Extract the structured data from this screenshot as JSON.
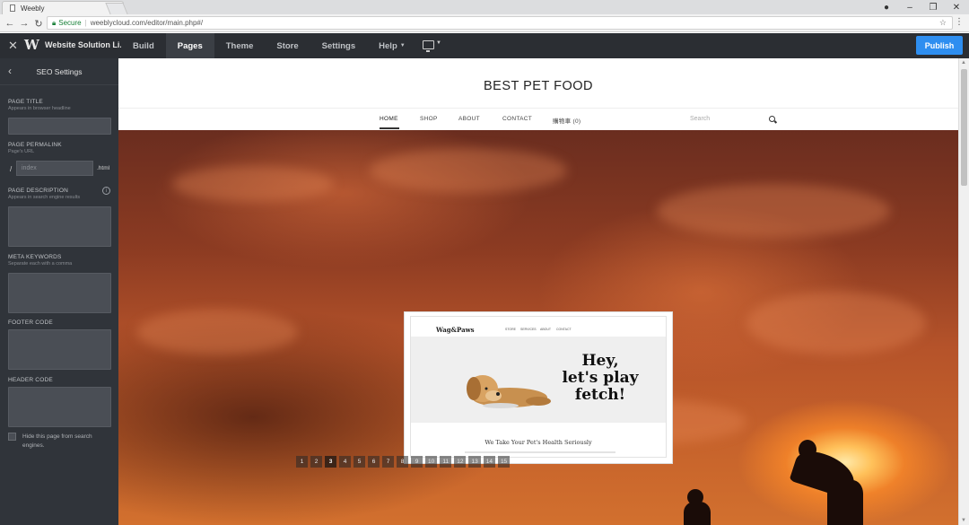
{
  "browser": {
    "tab_title": "Weebly",
    "secure_label": "Secure",
    "url": "weeblycloud.com/editor/main.php#/"
  },
  "editor": {
    "site_name": "Website Solution Li...",
    "nav": [
      {
        "label": "Build"
      },
      {
        "label": "Pages",
        "active": true
      },
      {
        "label": "Theme"
      },
      {
        "label": "Store"
      },
      {
        "label": "Settings"
      },
      {
        "label": "Help"
      }
    ],
    "publish_label": "Publish",
    "accent_color": "#2e8ef0"
  },
  "seo_panel": {
    "title": "SEO Settings",
    "page_title": {
      "label": "PAGE TITLE",
      "sub": "Appears in browser headline",
      "value": ""
    },
    "permalink": {
      "label": "PAGE PERMALINK",
      "sub": "Page's URL",
      "slash": "/",
      "placeholder": "index",
      "suffix": ".html"
    },
    "description": {
      "label": "PAGE DESCRIPTION",
      "sub": "Appears in search engine results",
      "value": ""
    },
    "keywords": {
      "label": "META KEYWORDS",
      "sub": "Separate each with a comma",
      "value": ""
    },
    "footer_code": {
      "label": "FOOTER CODE",
      "value": ""
    },
    "header_code": {
      "label": "HEADER CODE",
      "value": ""
    },
    "hide_page_label": "Hide this page from search engines."
  },
  "site": {
    "title": "BEST PET FOOD",
    "nav": [
      {
        "label": "HOME",
        "active": true
      },
      {
        "label": "SHOP"
      },
      {
        "label": "ABOUT"
      },
      {
        "label": "CONTACT"
      },
      {
        "label": "購物車 (0)"
      }
    ],
    "search_placeholder": "Search",
    "slide": {
      "logo": "Wag&Paws",
      "nav": [
        "STORE",
        "SERVICES",
        "ABOUT",
        "CONTACT"
      ],
      "headline_lines": [
        "Hey,",
        "let's play",
        "fetch!"
      ],
      "tagline": "We Take Your Pet's Health Seriously"
    },
    "pager": [
      "1",
      "2",
      "3",
      "4",
      "5",
      "6",
      "7",
      "8",
      "9",
      "10",
      "11",
      "12",
      "13",
      "14",
      "15"
    ],
    "pager_active": "3"
  }
}
